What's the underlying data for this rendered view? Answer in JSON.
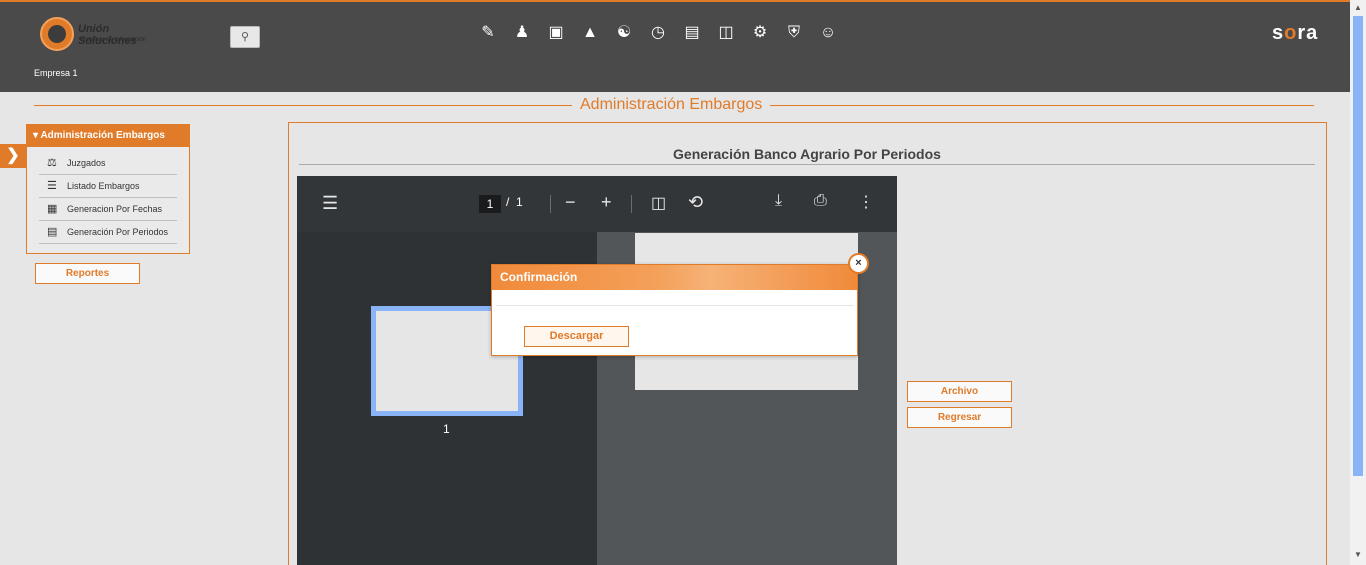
{
  "header": {
    "brand": "Unión Soluciones",
    "brand_sub": "Sistemas de Información",
    "search_icon": "search-icon",
    "company": "Empresa 1",
    "product_logo_left": "s",
    "product_logo_o": "o",
    "product_logo_right": "ra",
    "nav_icons": [
      "edit-document-icon",
      "user-money-icon",
      "gift-icon",
      "org-chart-icon",
      "user-transfer-icon",
      "timer-icon",
      "document-list-icon",
      "presentation-icon",
      "gears-icon",
      "shield-settings-icon",
      "group-icon"
    ]
  },
  "section": {
    "title": "Administración Embargos"
  },
  "sidebar": {
    "header": "Administración Embargos",
    "items": [
      {
        "label": "Juzgados",
        "icon": "gavel-icon"
      },
      {
        "label": "Listado Embargos",
        "icon": "list-icon"
      },
      {
        "label": "Generacion Por Fechas",
        "icon": "calendar-icon"
      },
      {
        "label": "Generación Por Periodos",
        "icon": "document-icon"
      }
    ],
    "reportes_label": "Reportes"
  },
  "main": {
    "title": "Generación Banco Agrario Por Periodos",
    "archivo_label": "Archivo",
    "regresar_label": "Regresar"
  },
  "pdf_viewer": {
    "current_page": "1",
    "page_separator": "/",
    "total_pages": "1",
    "thumbnail_number": "1"
  },
  "modal": {
    "title": "Confirmación",
    "download_label": "Descargar",
    "close_symbol": "×"
  },
  "colors": {
    "accent": "#e07b2a",
    "header_bg": "#4a4a4a",
    "pdf_toolbar": "#323639"
  }
}
